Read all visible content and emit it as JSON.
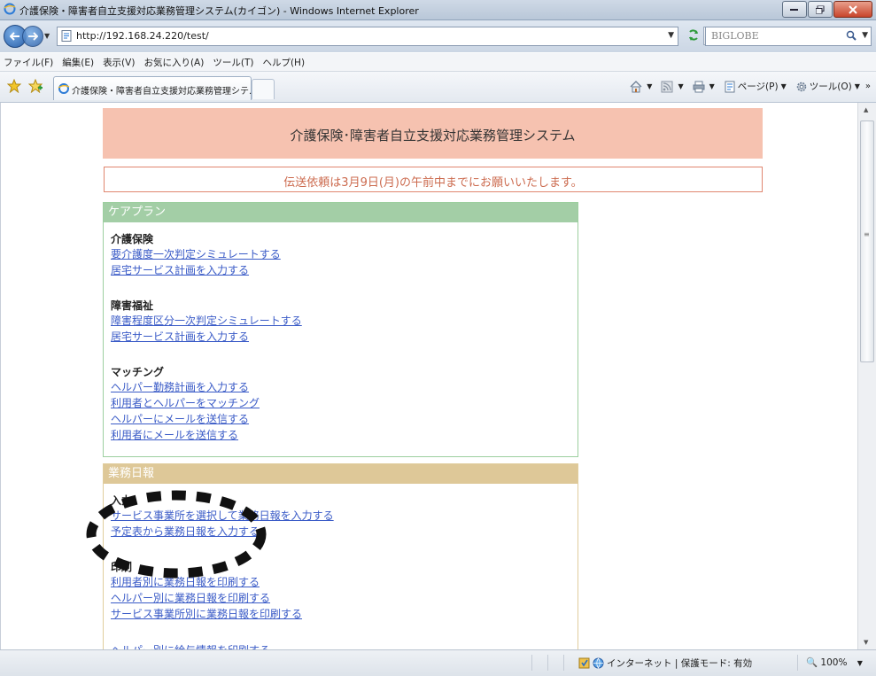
{
  "window": {
    "title": "介護保険・障害者自立支援対応業務管理システム(カイゴン) - Windows Internet Explorer"
  },
  "address": {
    "url": "http://192.168.24.220/test/",
    "search_engine": "BIGLOBE"
  },
  "menu": [
    "ファイル(F)",
    "編集(E)",
    "表示(V)",
    "お気に入り(A)",
    "ツール(T)",
    "ヘルプ(H)"
  ],
  "tab": {
    "label": "介護保険・障害者自立支援対応業務管理シテ..."
  },
  "commands": {
    "page": "ページ(P)",
    "tools": "ツール(O)",
    "more": "»"
  },
  "page": {
    "system_title": "介護保険･障害者自立支援対応業務管理システム",
    "notice": "伝送依頼は3月9日(月)の午前中までにお願いいたします。",
    "careplan": {
      "header": "ケアプラン",
      "sections": [
        {
          "title": "介護保険",
          "links": [
            "要介護度一次判定シミュレートする",
            "居宅サービス計画を入力する"
          ]
        },
        {
          "title": "障害福祉",
          "links": [
            "障害程度区分一次判定シミュレートする",
            "居宅サービス計画を入力する"
          ]
        },
        {
          "title": "マッチング",
          "links": [
            "ヘルパー勤務計画を入力する",
            "利用者とヘルパーをマッチング",
            "ヘルパーにメールを送信する",
            "利用者にメールを送信する"
          ]
        }
      ]
    },
    "nippo": {
      "header": "業務日報",
      "sections": [
        {
          "title": "入力",
          "links": [
            "サービス事業所を選択して業務日報を入力する",
            "予定表から業務日報を入力する"
          ]
        },
        {
          "title": "印刷",
          "links": [
            "利用者別に業務日報を印刷する",
            "ヘルパー別に業務日報を印刷する",
            "サービス事業所別に業務日報を印刷する"
          ]
        }
      ],
      "partial_link": "ヘルパー別に給与情報を印刷する"
    }
  },
  "status": {
    "zone": "インターネット | 保護モード: 有効",
    "zoom": "100%"
  },
  "colors": {
    "header_band": "#f6c2b0",
    "notice_border": "#e0866f",
    "careplan_header": "#a3cea6",
    "nippo_header": "#dec898",
    "link": "#3a5bc7"
  }
}
